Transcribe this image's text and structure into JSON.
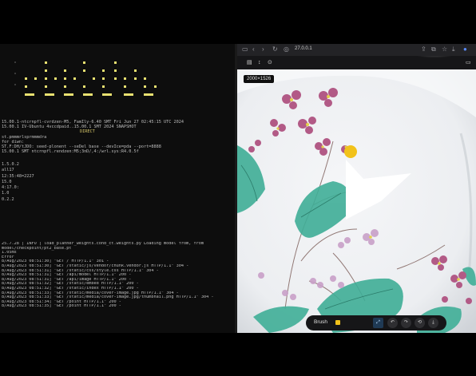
{
  "terminal": {
    "sysinfo": [
      "15.00.1-ntcrnpfl-cvrdzen-M5, FamIly-6.40 SMT Fri Jun 27 02:45:15 UTC 2024",
      "15.00.1 IV-Ubuntu 4vccdpaid..15.00.1 SMT 2024 SNAPSHOT",
      "DIRECT",
      "",
      "st.pmmmrlsprmmmdra",
      "for diwn:",
      "ST.F:DH/tJDO: seed-plonent --seDel base --devIce=pda --port=8888",
      "15.00.1 SMT ntcrnpfl.rendzen:M5;3nD/,4:/wrl.sys:R4.0.5f"
    ],
    "sysinfo_center": "DIRECT",
    "block2": [
      "1.5.0.2",
      "all17",
      "12:35:48=2227",
      "",
      "",
      "15.0",
      "4:17.0:",
      "1.0",
      "",
      "",
      "0.2.2"
    ],
    "block3": [
      "25.7.28  |  INFO     |  load_planner_weights.cond_ct.weights.py  Loading model from, from",
      "model/checkpoint/pt2_base.pt",
      "1.05ms",
      "Error",
      "8/Aug/2023 08:51:30] \"GET / HTTP/1.1\" 301 -",
      "8/Aug/2023 08:51:30] \"GET /static/js/vendor/chunk.vendor.js HTTP/1.1\" 304 -",
      "8/Aug/2023 08:51:31] \"GET /static/css/style.css HTTP/1.1\" 304 -",
      "8/Aug/2023 08:51:31] \"GET /api/model HTTP/1.1\" 200 -",
      "8/Aug/2023 08:51:31] \"GET /api/image HTTP/1.1\" 200 -",
      "8/Aug/2023 08:51:32] \"GET /static/embed HTTP/1.1\" 200 -",
      "8/Aug/2023 08:51:32] \"GET /static/index HTTP/1.1\" 200 -",
      "8/Aug/2023 08:51:33] \"GET /static/media/cover-image.jpg HTTP/1.1\" 304 -",
      "8/Aug/2023 08:51:33] \"GET /static/media/cover-image.jpg/thumbnail.png HTTP/1.1\" 304 -",
      "",
      "8/Aug/2023 08:51:34] \"GET /point HTTP/1.1\" 200 -",
      "8/Aug/2023 08:51:35] \"GET /point HTTP/1.1\" 200 -"
    ]
  },
  "browser": {
    "address": "27.0.0.1",
    "resolution": "2000×1526",
    "control": {
      "label": "Brush",
      "accent": "#f2c21a",
      "buttons": [
        {
          "icon": "expand-icon",
          "glyph": "⤢"
        },
        {
          "icon": "undo-icon",
          "glyph": "↶"
        },
        {
          "icon": "redo-icon",
          "glyph": "↷"
        },
        {
          "icon": "reset-icon",
          "glyph": "⟲"
        },
        {
          "icon": "download-icon",
          "glyph": "⤓"
        }
      ]
    }
  },
  "colors": {
    "terminal_bg": "#0d0d0d",
    "banner_yellow": "#e8e070",
    "brush_dot": "#f2c21a",
    "mask_white": "#ffffff"
  }
}
